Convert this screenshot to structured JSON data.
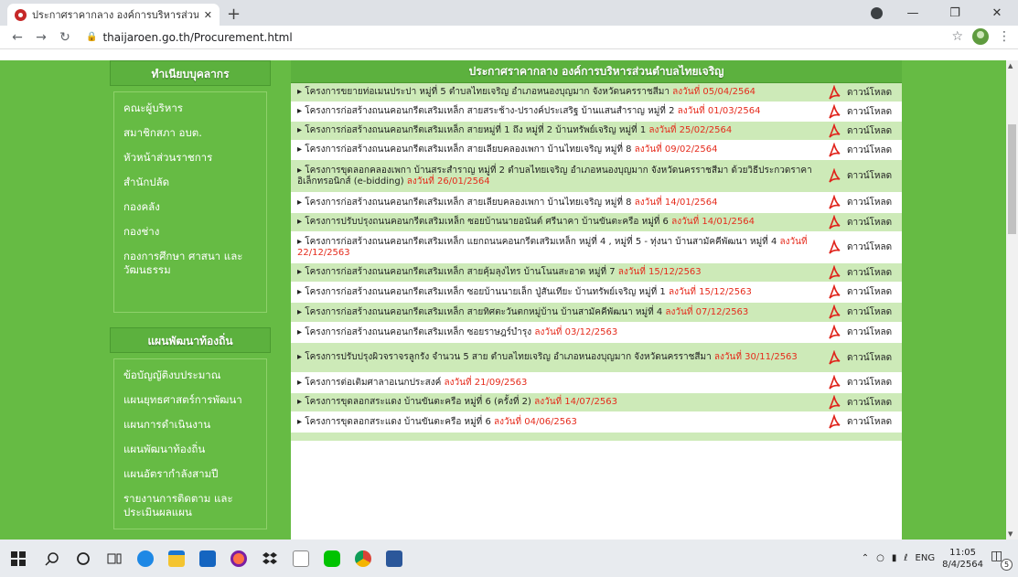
{
  "browser": {
    "tab_title": "ประกาศราคากลาง องค์การบริหารส่วน",
    "tab_close": "✕",
    "new_tab": "+",
    "url": "thaijaroen.go.th/Procurement.html"
  },
  "sidebar": {
    "personnel_header": "ทำเนียบบุคลากร",
    "personnel_items": [
      "คณะผู้บริหาร",
      "สมาชิกสภา อบต.",
      "หัวหน้าส่วนราชการ",
      "สำนักปลัด",
      "กองคลัง",
      "กองช่าง",
      "กองการศึกษา ศาสนา และวัฒนธรรม"
    ],
    "plan_header": "แผนพัฒนาท้องถิ่น",
    "plan_items": [
      "ข้อบัญญัติงบประมาณ",
      "แผนยุทธศาสตร์การพัฒนา",
      "แผนการดำเนินงาน",
      "แผนพัฒนาท้องถิ่น",
      "แผนอัตรากำลังสามปี",
      "รายงานการติดตาม และประเมินผลแผน"
    ]
  },
  "main": {
    "header": "ประกาศราคากลาง องค์การบริหารส่วนตำบลไทยเจริญ",
    "download_label": "ดาวน์โหลด",
    "rows": [
      {
        "text": "▸ โครงการขยายท่อเมนประปา หมู่ที่ 5 ตำบลไทยเจริญ อำเภอหนองบุญมาก จังหวัดนครราชสีมา ",
        "date": "ลงวันที่ 05/04/2564"
      },
      {
        "text": "▸ โครงการก่อสร้างถนนคอนกรีตเสริมเหล็ก สายสระช้าง-ปรางค์ประเสริฐ บ้านแสนสำราญ หมู่ที่ 2 ",
        "date": "ลงวันที่ 01/03/2564"
      },
      {
        "text": "▸ โครงการก่อสร้างถนนคอนกรีตเสริมเหล็ก สายหมู่ที่ 1 ถึง หมู่ที่ 2 บ้านทรัพย์เจริญ หมู่ที่ 1 ",
        "date": "ลงวันที่ 25/02/2564"
      },
      {
        "text": "▸ โครงการก่อสร้างถนนคอนกรีตเสริมเหล็ก สายเลียบคลองเพกา บ้านไทยเจริญ หมู่ที่ 8 ",
        "date": "ลงวันที่ 09/02/2564"
      },
      {
        "text": "▸ โครงการขุดลอกคลองเพกา บ้านสระสำราญ หมู่ที่ 2 ตำบลไทยเจริญ อำเภอหนองบุญมาก จังหวัดนครราชสีมา ด้วยวิธีประกวดราคาอิเล็กทรอนิกส์ (e-bidding) ",
        "date": "ลงวันที่ 26/01/2564"
      },
      {
        "text": "▸ โครงการก่อสร้างถนนคอนกรีตเสริมเหล็ก สายเลียบคลองเพกา บ้านไทยเจริญ หมู่ที่ 8 ",
        "date": "ลงวันที่ 14/01/2564"
      },
      {
        "text": "▸ โครงการปรับปรุงถนนคอนกรีตเสริมเหล็ก ซอยบ้านนายอนันต์ ศรีนาคา บ้านขันตะครือ หมู่ที่ 6 ",
        "date": "ลงวันที่ 14/01/2564"
      },
      {
        "text": "▸ โครงการก่อสร้างถนนคอนกรีตเสริมเหล็ก แยกถนนคอนกรีตเสริมเหล็ก หมู่ที่ 4 , หมู่ที่ 5 - ทุ่งนา บ้านสามัคคีพัฒนา หมู่ที่ 4 ",
        "date": "ลงวันที่ 22/12/2563"
      },
      {
        "text": "▸ โครงการก่อสร้างถนนคอนกรีตเสริมเหล็ก สายคุ้มลุงไทร บ้านโนนสะอาด หมู่ที่ 7 ",
        "date": "ลงวันที่ 15/12/2563"
      },
      {
        "text": "▸ โครงการก่อสร้างถนนคอนกรีตเสริมเหล็ก ซอยบ้านนายเล็ก ปู่สันเทียะ บ้านทรัพย์เจริญ หมู่ที่ 1 ",
        "date": "ลงวันที่ 15/12/2563"
      },
      {
        "text": "▸ โครงการก่อสร้างถนนคอนกรีตเสริมเหล็ก สายทิศตะวันตกหมู่บ้าน บ้านสามัคคีพัฒนา หมู่ที่ 4 ",
        "date": "ลงวันที่ 07/12/2563"
      },
      {
        "text": "▸ โครงการก่อสร้างถนนคอนกรีตเสริมเหล็ก ซอยราษฎร์บำรุง ",
        "date": "ลงวันที่ 03/12/2563"
      },
      {
        "text": "▸ โครงการปรับปรุงผิวจราจรลูกรัง จำนวน 5 สาย ตำบลไทยเจริญ อำเภอหนองบุญมาก จังหวัดนครราชสีมา ",
        "date": "ลงวันที่ 30/11/2563"
      },
      {
        "text": "▸ โครงการต่อเติมศาลาอเนกประสงค์ ",
        "date": "ลงวันที่ 21/09/2563"
      },
      {
        "text": "▸ โครงการขุดลอกสระแดง บ้านขันตะครือ หมู่ที่ 6 (ครั้งที่ 2) ",
        "date": "ลงวันที่ 14/07/2563"
      },
      {
        "text": "▸ โครงการขุดลอกสระแดง บ้านขันตะครือ หมู่ที่ 6 ",
        "date": "ลงวันที่ 04/06/2563"
      },
      {
        "text": "",
        "date": ""
      }
    ]
  },
  "taskbar": {
    "lang": "ENG",
    "time": "11:05",
    "date": "8/4/2564",
    "notif_count": "5"
  },
  "colors": {
    "page_green": "#66bb44",
    "row_alt": "#cdeab8",
    "date_red": "#e52b1c"
  }
}
